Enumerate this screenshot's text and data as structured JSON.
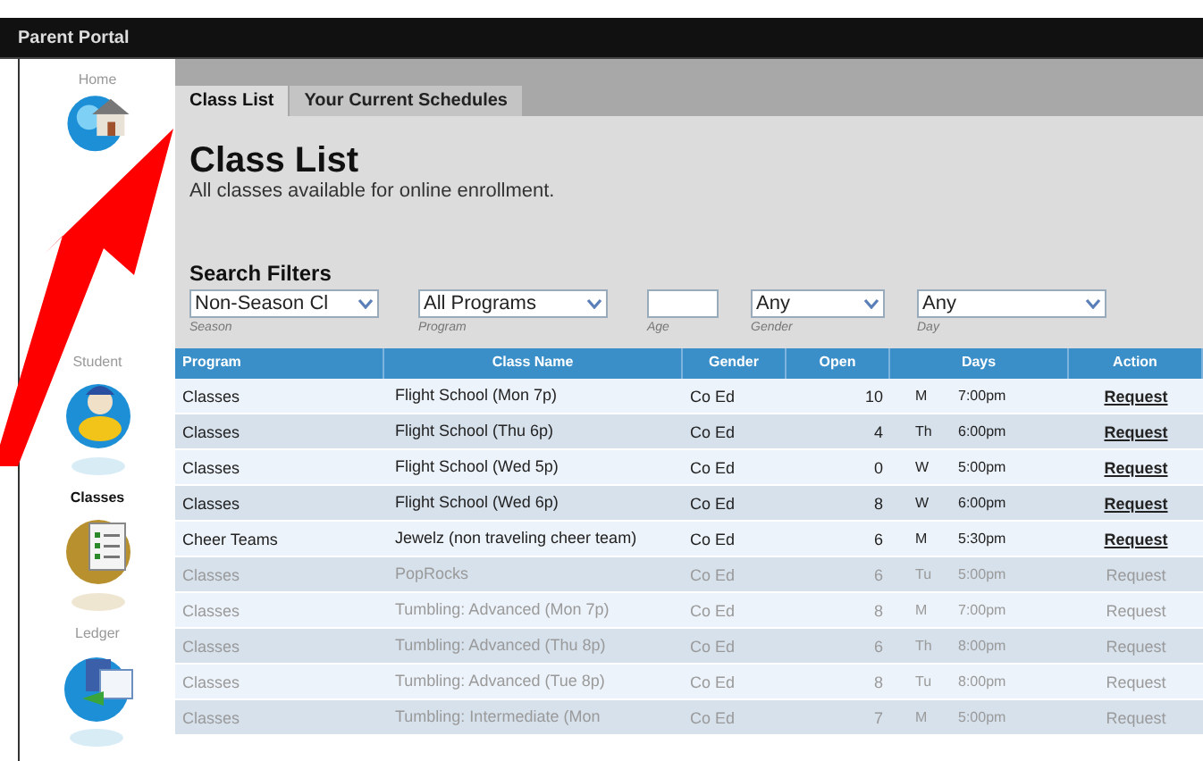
{
  "window": {
    "title": "Parent Portal"
  },
  "sidebar": {
    "items": [
      {
        "label": "Home",
        "kind": "home",
        "selected": false
      },
      {
        "label": "Student",
        "kind": "student",
        "selected": false
      },
      {
        "label": "Classes",
        "kind": "classes",
        "selected": true
      },
      {
        "label": "Ledger",
        "kind": "ledger",
        "selected": false
      }
    ]
  },
  "tabs": [
    {
      "label": "Class List",
      "selected": true
    },
    {
      "label": "Your Current Schedules",
      "selected": false
    }
  ],
  "page": {
    "title": "Class List",
    "subtitle": "All classes available for online enrollment."
  },
  "filters": {
    "heading": "Search Filters",
    "fields": [
      {
        "kind": "select",
        "value": "Non-Season Cl",
        "label": "Season"
      },
      {
        "kind": "select",
        "value": "All Programs",
        "label": "Program"
      },
      {
        "kind": "input",
        "label": "Age"
      },
      {
        "kind": "select",
        "value": "Any",
        "label": "Gender"
      },
      {
        "kind": "select",
        "value": "Any",
        "label": "Day"
      }
    ]
  },
  "table": {
    "columns": [
      "Program",
      "Class Name",
      "Gender",
      "Open",
      "Days",
      "Action"
    ],
    "rows": [
      {
        "program": "Classes",
        "class_name": "Flight School (Mon 7p)",
        "gender": "Co Ed",
        "open": "10",
        "day": "M",
        "time": "7:00pm",
        "action": "Request",
        "disabled": false
      },
      {
        "program": "Classes",
        "class_name": "Flight School (Thu 6p)",
        "gender": "Co Ed",
        "open": "4",
        "day": "Th",
        "time": "6:00pm",
        "action": "Request",
        "disabled": false
      },
      {
        "program": "Classes",
        "class_name": "Flight School (Wed 5p)",
        "gender": "Co Ed",
        "open": "0",
        "day": "W",
        "time": "5:00pm",
        "action": "Request",
        "disabled": false
      },
      {
        "program": "Classes",
        "class_name": "Flight School (Wed 6p)",
        "gender": "Co Ed",
        "open": "8",
        "day": "W",
        "time": "6:00pm",
        "action": "Request",
        "disabled": false
      },
      {
        "program": "Cheer Teams",
        "class_name": "Jewelz (non traveling cheer team)",
        "gender": "Co Ed",
        "open": "6",
        "day": "M",
        "time": "5:30pm",
        "action": "Request",
        "disabled": false
      },
      {
        "program": "Classes",
        "class_name": "PopRocks",
        "gender": "Co Ed",
        "open": "6",
        "day": "Tu",
        "time": "5:00pm",
        "action": "Request",
        "disabled": true
      },
      {
        "program": "Classes",
        "class_name": "Tumbling: Advanced (Mon 7p)",
        "gender": "Co Ed",
        "open": "8",
        "day": "M",
        "time": "7:00pm",
        "action": "Request",
        "disabled": true
      },
      {
        "program": "Classes",
        "class_name": "Tumbling: Advanced (Thu 8p)",
        "gender": "Co Ed",
        "open": "6",
        "day": "Th",
        "time": "8:00pm",
        "action": "Request",
        "disabled": true
      },
      {
        "program": "Classes",
        "class_name": "Tumbling: Advanced (Tue 8p)",
        "gender": "Co Ed",
        "open": "8",
        "day": "Tu",
        "time": "8:00pm",
        "action": "Request",
        "disabled": true
      },
      {
        "program": "Classes",
        "class_name": "Tumbling: Intermediate (Mon",
        "gender": "Co Ed",
        "open": "7",
        "day": "M",
        "time": "5:00pm",
        "action": "Request",
        "disabled": true
      }
    ]
  }
}
